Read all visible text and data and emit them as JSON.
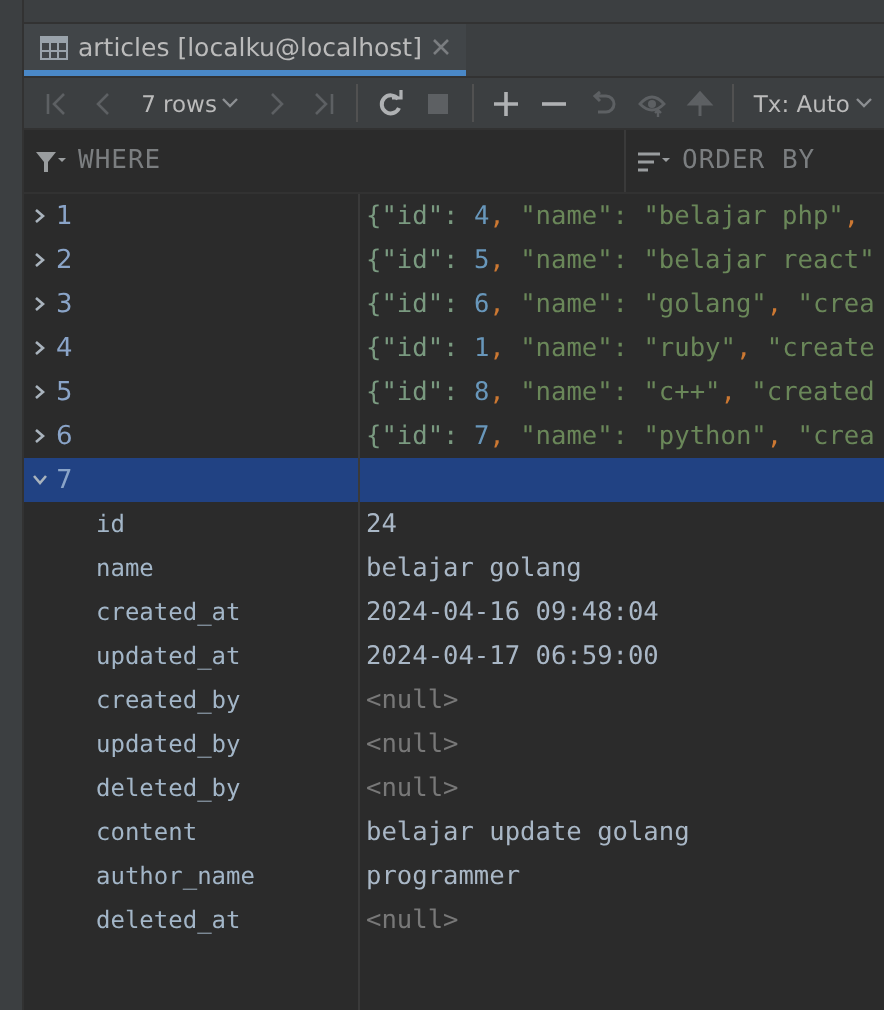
{
  "tab": {
    "title": "articles [localku@localhost]",
    "selected": true
  },
  "toolbar": {
    "row_count": "7 rows",
    "transaction": "Tx: Auto",
    "buttons": [
      {
        "kind": "first",
        "disabled": true
      },
      {
        "kind": "prev",
        "disabled": true
      },
      {
        "kind": "rows"
      },
      {
        "kind": "next",
        "disabled": true
      },
      {
        "kind": "last",
        "disabled": true
      },
      {
        "kind": "sep"
      },
      {
        "kind": "reload",
        "disabled": false
      },
      {
        "kind": "stop",
        "disabled": true
      },
      {
        "kind": "sep"
      },
      {
        "kind": "add",
        "disabled": false
      },
      {
        "kind": "remove",
        "disabled": false
      },
      {
        "kind": "revert",
        "disabled": true
      },
      {
        "kind": "preview",
        "disabled": true
      },
      {
        "kind": "submit",
        "disabled": true
      },
      {
        "kind": "sep"
      },
      {
        "kind": "tx"
      }
    ]
  },
  "filter": {
    "where": "WHERE",
    "order_by": "ORDER BY"
  },
  "rows": [
    {
      "number": "1",
      "expanded": false,
      "selected": false,
      "tokens": [
        {
          "kind": "punct",
          "text": "{\"id\": "
        },
        {
          "kind": "number",
          "text": "4"
        },
        {
          "kind": "comma",
          "text": ", "
        },
        {
          "kind": "string",
          "text": "\"name\": \"belajar php\""
        },
        {
          "kind": "comma",
          "text": ","
        }
      ]
    },
    {
      "number": "2",
      "expanded": false,
      "selected": false,
      "tokens": [
        {
          "kind": "punct",
          "text": "{\"id\": "
        },
        {
          "kind": "number",
          "text": "5"
        },
        {
          "kind": "comma",
          "text": ", "
        },
        {
          "kind": "string",
          "text": "\"name\": \"belajar react\""
        }
      ]
    },
    {
      "number": "3",
      "expanded": false,
      "selected": false,
      "tokens": [
        {
          "kind": "punct",
          "text": "{\"id\": "
        },
        {
          "kind": "number",
          "text": "6"
        },
        {
          "kind": "comma",
          "text": ", "
        },
        {
          "kind": "string",
          "text": "\"name\": \"golang\""
        },
        {
          "kind": "comma",
          "text": ", "
        },
        {
          "kind": "string",
          "text": "\"crea"
        }
      ]
    },
    {
      "number": "4",
      "expanded": false,
      "selected": false,
      "tokens": [
        {
          "kind": "punct",
          "text": "{\"id\": "
        },
        {
          "kind": "number",
          "text": "1"
        },
        {
          "kind": "comma",
          "text": ", "
        },
        {
          "kind": "string",
          "text": "\"name\": \"ruby\""
        },
        {
          "kind": "comma",
          "text": ", "
        },
        {
          "kind": "string",
          "text": "\"create"
        }
      ]
    },
    {
      "number": "5",
      "expanded": false,
      "selected": false,
      "tokens": [
        {
          "kind": "punct",
          "text": "{\"id\": "
        },
        {
          "kind": "number",
          "text": "8"
        },
        {
          "kind": "comma",
          "text": ", "
        },
        {
          "kind": "string",
          "text": "\"name\": \"c++\""
        },
        {
          "kind": "comma",
          "text": ", "
        },
        {
          "kind": "string",
          "text": "\"created"
        }
      ]
    },
    {
      "number": "6",
      "expanded": false,
      "selected": false,
      "tokens": [
        {
          "kind": "punct",
          "text": "{\"id\": "
        },
        {
          "kind": "number",
          "text": "7"
        },
        {
          "kind": "comma",
          "text": ", "
        },
        {
          "kind": "string",
          "text": "\"name\": \"python\""
        },
        {
          "kind": "comma",
          "text": ", "
        },
        {
          "kind": "string",
          "text": "\"crea"
        }
      ]
    },
    {
      "number": "7",
      "expanded": true,
      "selected": true,
      "fields": [
        {
          "name": "id",
          "value": "24",
          "null": false
        },
        {
          "name": "name",
          "value": "belajar golang",
          "null": false
        },
        {
          "name": "created_at",
          "value": "2024-04-16 09:48:04",
          "null": false
        },
        {
          "name": "updated_at",
          "value": "2024-04-17 06:59:00",
          "null": false
        },
        {
          "name": "created_by",
          "value": "<null>",
          "null": true
        },
        {
          "name": "updated_by",
          "value": "<null>",
          "null": true
        },
        {
          "name": "deleted_by",
          "value": "<null>",
          "null": true
        },
        {
          "name": "content",
          "value": "belajar update golang",
          "null": false
        },
        {
          "name": "author_name",
          "value": "programmer",
          "null": false
        },
        {
          "name": "deleted_at",
          "value": "<null>",
          "null": true
        }
      ]
    }
  ]
}
